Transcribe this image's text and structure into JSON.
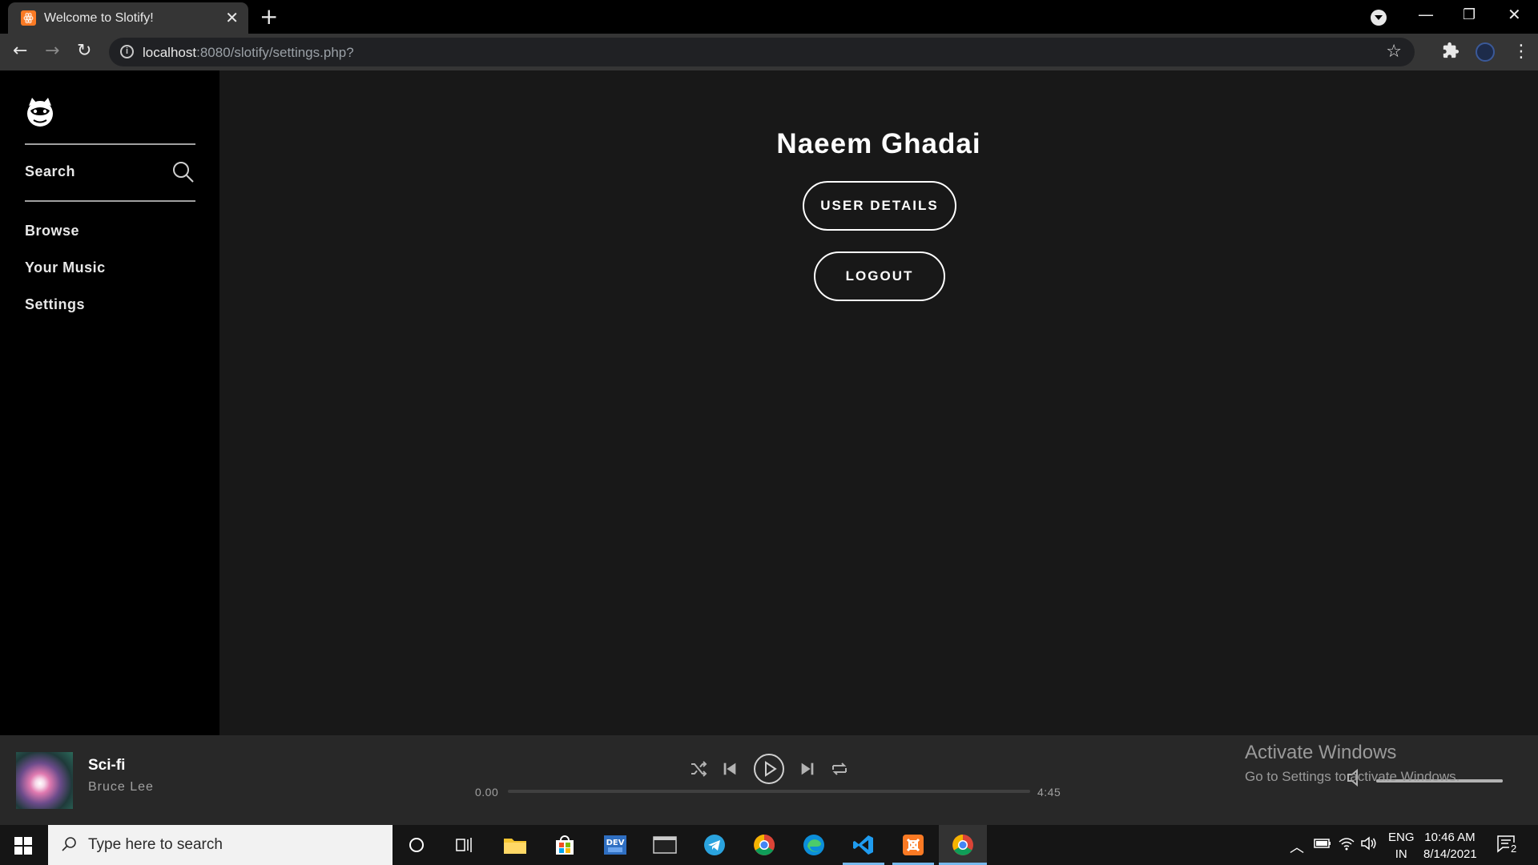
{
  "browser": {
    "tab_title": "Welcome to Slotify!",
    "tab_favicon_glyph": "ꙮ",
    "url_host": "localhost",
    "url_rest": ":8080/slotify/settings.php?"
  },
  "sidebar": {
    "search_label": "Search",
    "items": [
      {
        "label": "Browse"
      },
      {
        "label": "Your Music"
      },
      {
        "label": "Settings"
      }
    ]
  },
  "main": {
    "user_name": "Naeem Ghadai",
    "user_details_label": "USER DETAILS",
    "logout_label": "LOGOUT"
  },
  "player": {
    "song_title": "Sci-fi",
    "song_artist": "Bruce Lee",
    "current_time": "0.00",
    "total_time": "4:45",
    "progress": 0,
    "volume": 1
  },
  "watermark": {
    "title": "Activate Windows",
    "subtitle": "Go to Settings to activate Windows."
  },
  "taskbar": {
    "search_placeholder": "Type here to search",
    "lang_top": "ENG",
    "lang_bottom": "IN",
    "time": "10:46 AM",
    "date": "8/14/2021",
    "notification_count": "2",
    "apps": [
      "cortana-icon",
      "task-view-icon",
      "file-explorer-icon",
      "store-icon",
      "dev-icon",
      "terminal-icon",
      "telegram-icon",
      "chrome-icon",
      "edge-icon",
      "vscode-icon",
      "xampp-icon",
      "chrome-active-icon"
    ]
  },
  "colors": {
    "sidebar_bg": "#000000",
    "main_bg": "#181818",
    "player_bg": "#282828",
    "text_primary": "#ffffff",
    "text_secondary": "#a0a0a0",
    "chrome_toolbar": "#353535"
  }
}
